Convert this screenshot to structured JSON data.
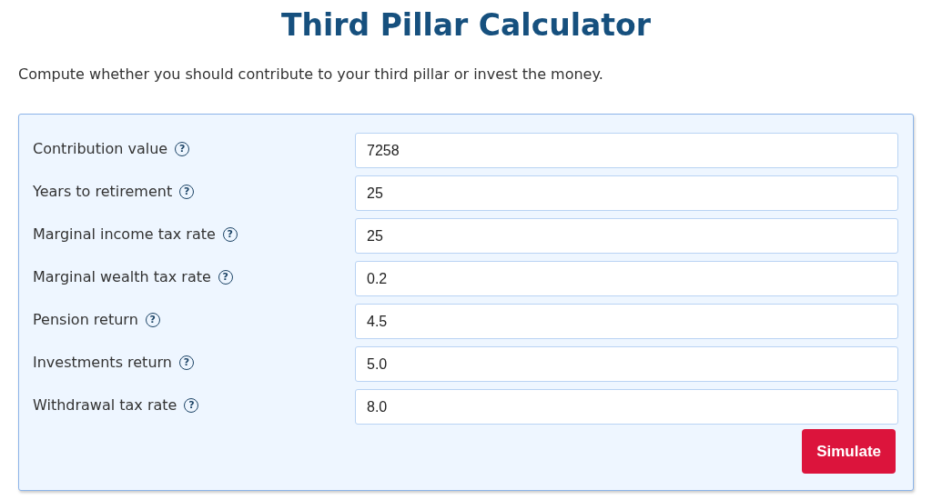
{
  "title": "Third Pillar Calculator",
  "intro": "Compute whether you should contribute to your third pillar or invest the money.",
  "fields": [
    {
      "label": "Contribution value",
      "help": "?",
      "value": "7258"
    },
    {
      "label": "Years to retirement",
      "help": "?",
      "value": "25"
    },
    {
      "label": "Marginal income tax rate",
      "help": "?",
      "value": "25"
    },
    {
      "label": "Marginal wealth tax rate",
      "help": "?",
      "value": "0.2"
    },
    {
      "label": "Pension return",
      "help": "?",
      "value": "4.5"
    },
    {
      "label": "Investments return",
      "help": "?",
      "value": "5.0"
    },
    {
      "label": "Withdrawal tax rate",
      "help": "?",
      "value": "8.0"
    }
  ],
  "button": "Simulate"
}
